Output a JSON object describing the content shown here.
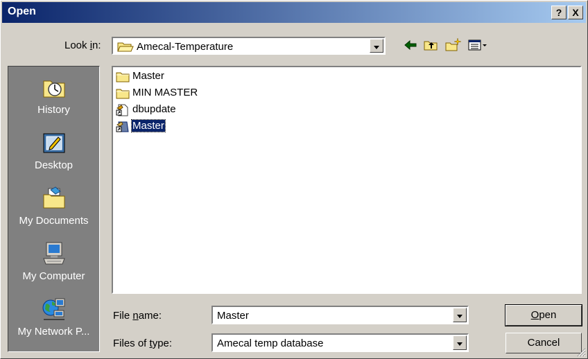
{
  "window": {
    "title": "Open",
    "help_label": "?",
    "close_label": "X"
  },
  "lookin": {
    "label": "Look in:",
    "value": "Amecal-Temperature"
  },
  "toolbar": {
    "icons": [
      "back-icon",
      "up-folder-icon",
      "new-folder-icon",
      "view-menu-icon"
    ]
  },
  "places": [
    {
      "label": "History",
      "icon": "history-icon"
    },
    {
      "label": "Desktop",
      "icon": "desktop-icon"
    },
    {
      "label": "My Documents",
      "icon": "my-documents-icon"
    },
    {
      "label": "My Computer",
      "icon": "my-computer-icon"
    },
    {
      "label": "My Network P...",
      "icon": "my-network-places-icon"
    }
  ],
  "files": [
    {
      "name": "Master",
      "icon": "folder-icon"
    },
    {
      "name": "MIN MASTER",
      "icon": "folder-icon"
    },
    {
      "name": "dbupdate",
      "icon": "shortcut-icon"
    },
    {
      "name": "Master",
      "icon": "database-shortcut-icon",
      "selected": true
    }
  ],
  "filename": {
    "label": "File name:",
    "value": "Master"
  },
  "filetype": {
    "label": "Files of type:",
    "value": "Amecal temp database"
  },
  "buttons": {
    "open": "Open",
    "cancel": "Cancel"
  },
  "colors": {
    "title_start": "#0a246a",
    "title_end": "#a6caf0",
    "selection": "#0a246a",
    "face": "#d4d0c8"
  }
}
